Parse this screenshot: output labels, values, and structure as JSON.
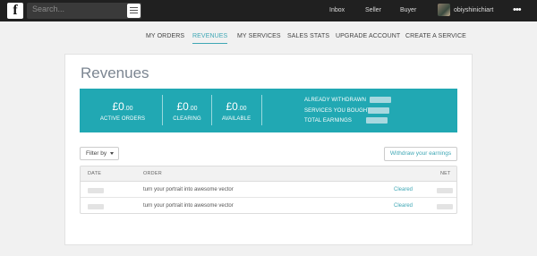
{
  "topbar": {
    "logo": "f",
    "search_placeholder": "Search...",
    "links": [
      "Inbox",
      "Seller",
      "Buyer"
    ],
    "username": "obiyshinichiart",
    "more": "•••"
  },
  "subnav": [
    "MY ORDERS",
    "REVENUES",
    "MY SERVICES",
    "SALES STATS",
    "UPGRADE ACCOUNT",
    "CREATE A SERVICE"
  ],
  "page_title": "Revenues",
  "stats": [
    {
      "amount": "£0",
      "cents": ".00",
      "label": "ACTIVE ORDERS"
    },
    {
      "amount": "£0",
      "cents": ".00",
      "label": "CLEARING"
    },
    {
      "amount": "£0",
      "cents": ".00",
      "label": "AVAILABLE"
    }
  ],
  "summary": [
    "ALREADY WITHDRAWN",
    "SERVICES YOU BOUGHT",
    "TOTAL EARNINGS"
  ],
  "filter_label": "Filter by",
  "withdraw_label": "Withdraw your earnings",
  "table": {
    "headers": [
      "DATE",
      "ORDER",
      "NET"
    ],
    "rows": [
      {
        "order": "turn your portrait into awesome vector",
        "status": "Cleared"
      },
      {
        "order": "turn your portrait into awesome vector",
        "status": "Cleared"
      }
    ]
  },
  "colors": {
    "accent": "#21a8b3",
    "link": "#3fa7b5",
    "topbar": "#202020"
  }
}
